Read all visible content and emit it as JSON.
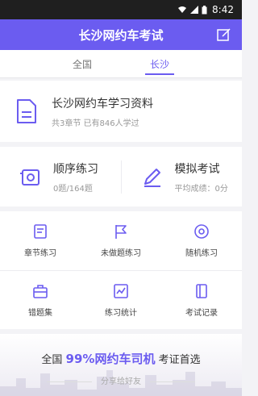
{
  "status_bar": {
    "time": "8:42"
  },
  "app_bar": {
    "title": "长沙网约车考试"
  },
  "tabs": [
    {
      "label": "全国",
      "active": false
    },
    {
      "label": "长沙",
      "active": true
    }
  ],
  "material": {
    "title": "长沙网约车学习资料",
    "subtitle": "共3章节  已有846人学过"
  },
  "practice": {
    "sequential": {
      "title": "顺序练习",
      "subtitle": "0题/164题"
    },
    "mock_exam": {
      "title": "模拟考试",
      "subtitle": "平均成绩：0分"
    }
  },
  "grid": {
    "row1": [
      {
        "label": "章节练习",
        "icon": "chapter-icon"
      },
      {
        "label": "未做题练习",
        "icon": "flag-icon"
      },
      {
        "label": "随机练习",
        "icon": "random-icon"
      }
    ],
    "row2": [
      {
        "label": "错题集",
        "icon": "briefcase-icon"
      },
      {
        "label": "练习统计",
        "icon": "chart-icon"
      },
      {
        "label": "考试记录",
        "icon": "record-icon"
      }
    ]
  },
  "banner": {
    "prefix": "全国 ",
    "highlight": "99%网约车司机",
    "suffix": " 考证首选",
    "share": "分享给好友"
  },
  "colors": {
    "accent": "#6b5cf0",
    "statusbar": "#1f1f1f"
  }
}
